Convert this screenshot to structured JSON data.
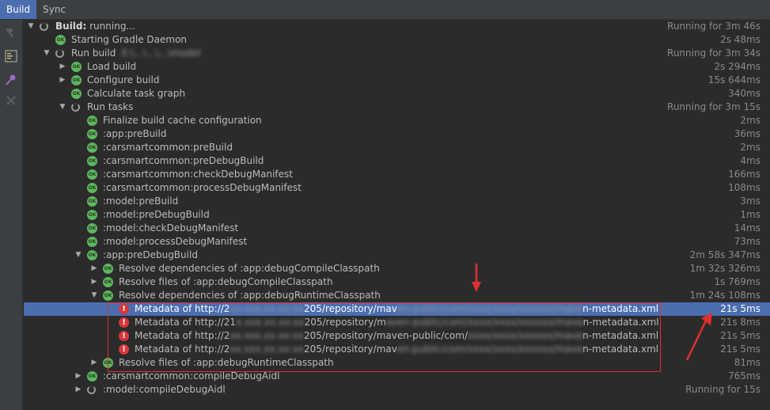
{
  "tabs": [
    {
      "label": "Build",
      "active": true
    },
    {
      "label": "Sync",
      "active": false
    }
  ],
  "toolbar": [
    "hammer-icon",
    "toggle-view-icon",
    "pin-icon",
    "close-icon"
  ],
  "tree": [
    {
      "depth": 0,
      "arrow": "down",
      "icon": "run",
      "label": "Build:",
      "label_rest": " running...",
      "time": "Running for 3m 46s"
    },
    {
      "depth": 1,
      "arrow": "",
      "icon": "ok",
      "label": "Starting Gradle Daemon",
      "time": "2s 48ms"
    },
    {
      "depth": 1,
      "arrow": "down",
      "icon": "run",
      "label": "Run build",
      "blur": "E:\\...\\...\\...\\model",
      "time": "Running for 3m 34s"
    },
    {
      "depth": 2,
      "arrow": "right",
      "icon": "ok",
      "label": "Load build",
      "time": "2s 294ms"
    },
    {
      "depth": 2,
      "arrow": "right",
      "icon": "ok",
      "label": "Configure build",
      "time": "15s 644ms"
    },
    {
      "depth": 2,
      "arrow": "",
      "icon": "ok",
      "label": "Calculate task graph",
      "time": "340ms"
    },
    {
      "depth": 2,
      "arrow": "down",
      "icon": "run",
      "label": "Run tasks",
      "time": "Running for 3m 15s"
    },
    {
      "depth": 3,
      "arrow": "",
      "icon": "ok",
      "label": "Finalize build cache configuration",
      "time": "2ms"
    },
    {
      "depth": 3,
      "arrow": "",
      "icon": "ok",
      "label": ":app:preBuild",
      "time": "36ms"
    },
    {
      "depth": 3,
      "arrow": "",
      "icon": "ok",
      "label": ":carsmartcommon:preBuild",
      "time": "2ms"
    },
    {
      "depth": 3,
      "arrow": "",
      "icon": "ok",
      "label": ":carsmartcommon:preDebugBuild",
      "time": "4ms"
    },
    {
      "depth": 3,
      "arrow": "",
      "icon": "ok",
      "label": ":carsmartcommon:checkDebugManifest",
      "time": "166ms"
    },
    {
      "depth": 3,
      "arrow": "",
      "icon": "ok",
      "label": ":carsmartcommon:processDebugManifest",
      "time": "108ms"
    },
    {
      "depth": 3,
      "arrow": "",
      "icon": "ok",
      "label": ":model:preBuild",
      "time": "3ms"
    },
    {
      "depth": 3,
      "arrow": "",
      "icon": "ok",
      "label": ":model:preDebugBuild",
      "time": "1ms"
    },
    {
      "depth": 3,
      "arrow": "",
      "icon": "ok",
      "label": ":model:checkDebugManifest",
      "time": "14ms"
    },
    {
      "depth": 3,
      "arrow": "",
      "icon": "ok",
      "label": ":model:processDebugManifest",
      "time": "73ms"
    },
    {
      "depth": 3,
      "arrow": "down",
      "icon": "ok",
      "label": ":app:preDebugBuild",
      "time": "2m 58s 347ms"
    },
    {
      "depth": 4,
      "arrow": "right",
      "icon": "ok",
      "label": "Resolve dependencies of :app:debugCompileClasspath",
      "time": "1m 32s 326ms"
    },
    {
      "depth": 4,
      "arrow": "right",
      "icon": "ok",
      "label": "Resolve files of :app:debugCompileClasspath",
      "time": "1s 769ms"
    },
    {
      "depth": 4,
      "arrow": "down",
      "icon": "ok",
      "label": "Resolve dependencies of :app:debugRuntimeClasspath",
      "time": "1m 24s 108ms"
    },
    {
      "depth": 5,
      "arrow": "",
      "icon": "err",
      "label": "Metadata of http://2",
      "blur": "xx.xxx.xx.xx:xx",
      "label_rest": "205/repository/mav",
      "blur2": "en-public/com/xxxx/xxxx/xxxxxx/mave",
      "label_tail": "n-metadata.xml",
      "time": "21s 5ms",
      "selected": true
    },
    {
      "depth": 5,
      "arrow": "",
      "icon": "err",
      "label": "Metadata of http://21",
      "blur": "x.xxx.xx.xx:xx",
      "label_rest": "205/repository/m",
      "blur2": "aven-public/com/xxxx/xxxx/xxxxxx/mave",
      "label_tail": "n-metadata.xml",
      "time": "21s 8ms"
    },
    {
      "depth": 5,
      "arrow": "",
      "icon": "err",
      "label": "Metadata of http://2",
      "blur": "xx.xxx.xx.xx:xx",
      "label_rest": "205/repository/maven-public/com/",
      "blur2": "xxxx/xxxx/xxxxxx/mave",
      "label_tail": "n-metadata.xml",
      "time": "21s 5ms"
    },
    {
      "depth": 5,
      "arrow": "",
      "icon": "err",
      "label": "Metadata of http://2",
      "blur": "xx.xxx.xx.xx:xx",
      "label_rest": "205/repository/mav",
      "blur2": "en-public/com/xxxx/xxxx/xxxxxx/mave",
      "label_tail": "n-metadata.xml",
      "time": "21s 5ms"
    },
    {
      "depth": 4,
      "arrow": "right",
      "icon": "ok",
      "label": "Resolve files of :app:debugRuntimeClasspath",
      "time": "81ms"
    },
    {
      "depth": 3,
      "arrow": "right",
      "icon": "ok",
      "label": ":carsmartcommon:compileDebugAidl",
      "time": "765ms"
    },
    {
      "depth": 3,
      "arrow": "right",
      "icon": "run",
      "label": ":model:compileDebugAidl",
      "time": "Running for 15s"
    }
  ],
  "icon_ok_text": "OK",
  "icon_err_text": "!",
  "colors": {
    "selection": "#4b6eaf",
    "ok": "#5fb65f",
    "error": "#d8363a",
    "annotation": "#e03030"
  }
}
